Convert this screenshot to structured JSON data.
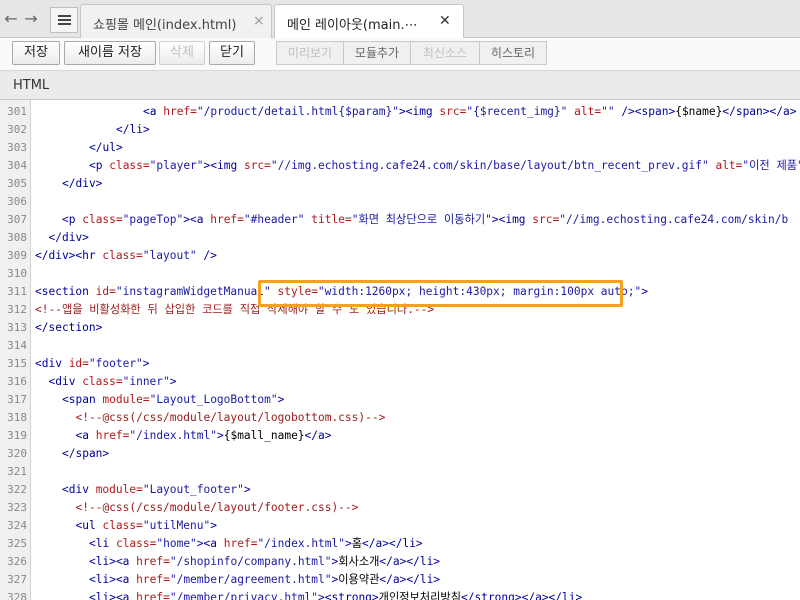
{
  "tabs": [
    {
      "label": "쇼핑몰 메인(index.html)",
      "close": "×",
      "active": false
    },
    {
      "label": "메인 레이아웃(main.⋯",
      "close": "✕",
      "active": true
    }
  ],
  "nav": {
    "back_icon": "arrow-left-icon",
    "forward_icon": "arrow-right-icon",
    "tab_list_icon": "list-icon"
  },
  "toolbar": {
    "save_label": "저장",
    "save_as_label": "새이름 저장",
    "delete_label": "삭제",
    "close_label": "닫기",
    "preview_label": "미리보기",
    "module_add_label": "모듈추가",
    "latest_source_label": "최신소스",
    "history_label": "히스토리"
  },
  "file_type": "HTML",
  "editor": {
    "lines": [
      {
        "n": "301",
        "indent": 16,
        "parts": [
          [
            "tag",
            "<a "
          ],
          [
            "attr",
            "href="
          ],
          [
            "str",
            "\"/product/detail.html{$param}\""
          ],
          [
            "tag",
            "><img "
          ],
          [
            "attr",
            "src="
          ],
          [
            "str",
            "\"{$recent_img}\""
          ],
          [
            "attr",
            " alt="
          ],
          [
            "str",
            "\"\""
          ],
          [
            "tag",
            " /><span>"
          ],
          [
            "txt",
            "{$name}"
          ],
          [
            "tag",
            "</span></a>"
          ]
        ]
      },
      {
        "n": "302",
        "indent": 12,
        "parts": [
          [
            "tag",
            "</li>"
          ]
        ]
      },
      {
        "n": "303",
        "indent": 8,
        "parts": [
          [
            "tag",
            "</ul>"
          ]
        ]
      },
      {
        "n": "304",
        "indent": 8,
        "parts": [
          [
            "tag",
            "<p "
          ],
          [
            "attr",
            "class="
          ],
          [
            "str",
            "\"player\""
          ],
          [
            "tag",
            "><img "
          ],
          [
            "attr",
            "src="
          ],
          [
            "str",
            "\"//img.echosting.cafe24.com/skin/base/layout/btn_recent_prev.gif\""
          ],
          [
            "attr",
            " alt="
          ],
          [
            "str",
            "\"이전 제품\""
          ]
        ]
      },
      {
        "n": "305",
        "indent": 4,
        "parts": [
          [
            "tag",
            "</div>"
          ]
        ]
      },
      {
        "n": "306",
        "indent": 0,
        "parts": []
      },
      {
        "n": "307",
        "indent": 4,
        "parts": [
          [
            "tag",
            "<p "
          ],
          [
            "attr",
            "class="
          ],
          [
            "str",
            "\"pageTop\""
          ],
          [
            "tag",
            "><a "
          ],
          [
            "attr",
            "href="
          ],
          [
            "str",
            "\"#header\""
          ],
          [
            "attr",
            " title="
          ],
          [
            "str",
            "\"화면 최상단으로 이동하기\""
          ],
          [
            "tag",
            "><img "
          ],
          [
            "attr",
            "src="
          ],
          [
            "str",
            "\"//img.echosting.cafe24.com/skin/b"
          ]
        ]
      },
      {
        "n": "308",
        "indent": 2,
        "parts": [
          [
            "tag",
            "</div>"
          ]
        ]
      },
      {
        "n": "309",
        "indent": 0,
        "parts": [
          [
            "tag",
            "</div><hr "
          ],
          [
            "attr",
            "class="
          ],
          [
            "str",
            "\"layout\""
          ],
          [
            "tag",
            " />"
          ]
        ]
      },
      {
        "n": "310",
        "indent": 0,
        "parts": []
      },
      {
        "n": "311",
        "indent": 0,
        "parts": [
          [
            "tag",
            "<section "
          ],
          [
            "attr",
            "id="
          ],
          [
            "str",
            "\"instagramWidgetManual\""
          ],
          [
            "attr",
            " style="
          ],
          [
            "str",
            "\"width:1260px; height:430px; margin:100px auto;\""
          ],
          [
            "tag",
            ">"
          ]
        ]
      },
      {
        "n": "312",
        "indent": 0,
        "parts": [
          [
            "cmt",
            "<!--앱을 비활성화한 뒤 삽입한 코드를 직접 삭제해야 할 수 도 있습니다.-->"
          ]
        ]
      },
      {
        "n": "313",
        "indent": 0,
        "parts": [
          [
            "tag",
            "</section>"
          ]
        ]
      },
      {
        "n": "314",
        "indent": 0,
        "parts": []
      },
      {
        "n": "315",
        "indent": 0,
        "parts": [
          [
            "tag",
            "<div "
          ],
          [
            "attr",
            "id="
          ],
          [
            "str",
            "\"footer\""
          ],
          [
            "tag",
            ">"
          ]
        ]
      },
      {
        "n": "316",
        "indent": 2,
        "parts": [
          [
            "tag",
            "<div "
          ],
          [
            "attr",
            "class="
          ],
          [
            "str",
            "\"inner\""
          ],
          [
            "tag",
            ">"
          ]
        ]
      },
      {
        "n": "317",
        "indent": 4,
        "parts": [
          [
            "tag",
            "<span "
          ],
          [
            "attr",
            "module="
          ],
          [
            "str",
            "\"Layout_LogoBottom\""
          ],
          [
            "tag",
            ">"
          ]
        ]
      },
      {
        "n": "318",
        "indent": 6,
        "parts": [
          [
            "cmt",
            "<!--@css(/css/module/layout/logobottom.css)-->"
          ]
        ]
      },
      {
        "n": "319",
        "indent": 6,
        "parts": [
          [
            "tag",
            "<a "
          ],
          [
            "attr",
            "href="
          ],
          [
            "str",
            "\"/index.html\""
          ],
          [
            "tag",
            ">"
          ],
          [
            "txt",
            "{$mall_name}"
          ],
          [
            "tag",
            "</a>"
          ]
        ]
      },
      {
        "n": "320",
        "indent": 4,
        "parts": [
          [
            "tag",
            "</span>"
          ]
        ]
      },
      {
        "n": "321",
        "indent": 0,
        "parts": []
      },
      {
        "n": "322",
        "indent": 4,
        "parts": [
          [
            "tag",
            "<div "
          ],
          [
            "attr",
            "module="
          ],
          [
            "str",
            "\"Layout_footer\""
          ],
          [
            "tag",
            ">"
          ]
        ]
      },
      {
        "n": "323",
        "indent": 6,
        "parts": [
          [
            "cmt",
            "<!--@css(/css/module/layout/footer.css)-->"
          ]
        ]
      },
      {
        "n": "324",
        "indent": 6,
        "parts": [
          [
            "tag",
            "<ul "
          ],
          [
            "attr",
            "class="
          ],
          [
            "str",
            "\"utilMenu\""
          ],
          [
            "tag",
            ">"
          ]
        ]
      },
      {
        "n": "325",
        "indent": 8,
        "parts": [
          [
            "tag",
            "<li "
          ],
          [
            "attr",
            "class="
          ],
          [
            "str",
            "\"home\""
          ],
          [
            "tag",
            "><a "
          ],
          [
            "attr",
            "href="
          ],
          [
            "str",
            "\"/index.html\""
          ],
          [
            "tag",
            ">"
          ],
          [
            "txt",
            "홈"
          ],
          [
            "tag",
            "</a></li>"
          ]
        ]
      },
      {
        "n": "326",
        "indent": 8,
        "parts": [
          [
            "tag",
            "<li><a "
          ],
          [
            "attr",
            "href="
          ],
          [
            "str",
            "\"/shopinfo/company.html\""
          ],
          [
            "tag",
            ">"
          ],
          [
            "txt",
            "회사소개"
          ],
          [
            "tag",
            "</a></li>"
          ]
        ]
      },
      {
        "n": "327",
        "indent": 8,
        "parts": [
          [
            "tag",
            "<li><a "
          ],
          [
            "attr",
            "href="
          ],
          [
            "str",
            "\"/member/agreement.html\""
          ],
          [
            "tag",
            ">"
          ],
          [
            "txt",
            "이용약관"
          ],
          [
            "tag",
            "</a></li>"
          ]
        ]
      },
      {
        "n": "328",
        "indent": 8,
        "parts": [
          [
            "tag",
            "<li><a "
          ],
          [
            "attr",
            "href="
          ],
          [
            "str",
            "\"/member/privacy.html\""
          ],
          [
            "tag",
            "><strong>"
          ],
          [
            "txt",
            "개인정보처리방침"
          ],
          [
            "tag",
            "</strong></a></li>"
          ]
        ]
      }
    ],
    "highlighted_text": "style=\"width:1260px; height:430px; margin:100px auto;\">"
  },
  "colors": {
    "highlight": "#f5a11b",
    "tag": "#00009a",
    "attr": "#b2191b",
    "string": "#1a1aa6",
    "comment": "#9a1b1b"
  }
}
